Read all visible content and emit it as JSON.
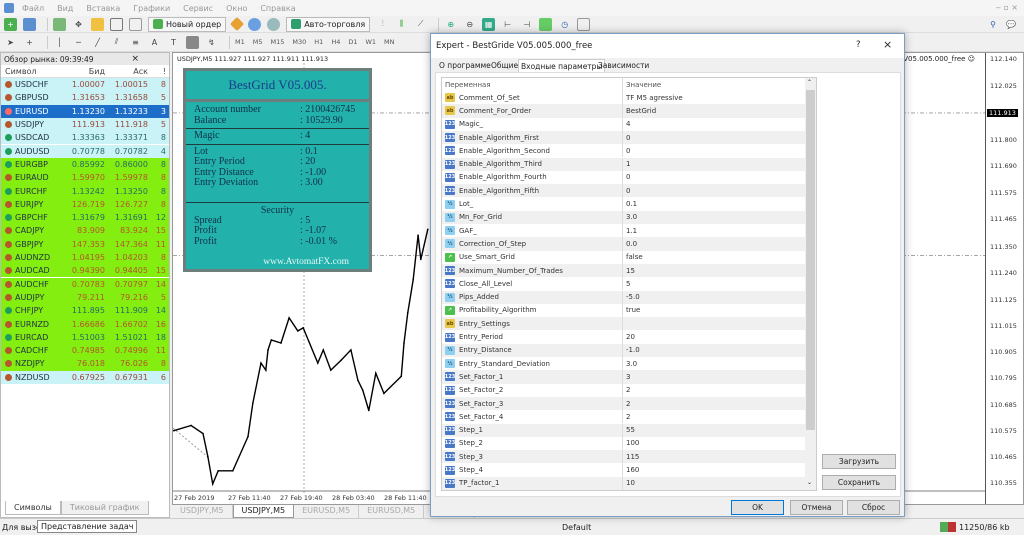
{
  "menu": [
    "Файл",
    "Вид",
    "Вставка",
    "Графики",
    "Сервис",
    "Окно",
    "Справка"
  ],
  "toolbar": {
    "new_order": "Новый ордер",
    "autotrading": "Авто-торговля"
  },
  "timeframes": [
    "M1",
    "M5",
    "M15",
    "M30",
    "H1",
    "H4",
    "D1",
    "W1",
    "MN"
  ],
  "market_watch": {
    "title": "Обзор рынка: 09:39:49",
    "columns": [
      "Символ",
      "Бид",
      "Аск",
      "!"
    ],
    "selected": "EURUSD",
    "colors": {
      "cyan": "#c9f3f7",
      "green": "#83ee0f",
      "selected": "#1c6ec9",
      "up": "#1e9e5a",
      "down": "#b5562e"
    },
    "rows": [
      {
        "symbol": "USDCHF",
        "bid": "1.00007",
        "ask": "1.00015",
        "spread": "8",
        "dir": "down",
        "bg": "cyan"
      },
      {
        "symbol": "GBPUSD",
        "bid": "1.31653",
        "ask": "1.31658",
        "spread": "5",
        "dir": "down",
        "bg": "cyan"
      },
      {
        "symbol": "EURUSD",
        "bid": "1.13230",
        "ask": "1.13233",
        "spread": "3",
        "dir": "down",
        "bg": "selected"
      },
      {
        "symbol": "USDJPY",
        "bid": "111.913",
        "ask": "111.918",
        "spread": "5",
        "dir": "down",
        "bg": "cyan"
      },
      {
        "symbol": "USDCAD",
        "bid": "1.33363",
        "ask": "1.33371",
        "spread": "8",
        "dir": "up",
        "bg": "cyan"
      },
      {
        "symbol": "AUDUSD",
        "bid": "0.70778",
        "ask": "0.70782",
        "spread": "4",
        "dir": "up",
        "bg": "cyan"
      },
      {
        "symbol": "EURGBP",
        "bid": "0.85992",
        "ask": "0.86000",
        "spread": "8",
        "dir": "up",
        "bg": "green"
      },
      {
        "symbol": "EURAUD",
        "bid": "1.59970",
        "ask": "1.59978",
        "spread": "8",
        "dir": "down",
        "bg": "green"
      },
      {
        "symbol": "EURCHF",
        "bid": "1.13242",
        "ask": "1.13250",
        "spread": "8",
        "dir": "up",
        "bg": "green"
      },
      {
        "symbol": "EURJPY",
        "bid": "126.719",
        "ask": "126.727",
        "spread": "8",
        "dir": "down",
        "bg": "green"
      },
      {
        "symbol": "GBPCHF",
        "bid": "1.31679",
        "ask": "1.31691",
        "spread": "12",
        "dir": "up",
        "bg": "green"
      },
      {
        "symbol": "CADJPY",
        "bid": "83.909",
        "ask": "83.924",
        "spread": "15",
        "dir": "down",
        "bg": "green"
      },
      {
        "symbol": "GBPJPY",
        "bid": "147.353",
        "ask": "147.364",
        "spread": "11",
        "dir": "down",
        "bg": "green"
      },
      {
        "symbol": "AUDNZD",
        "bid": "1.04195",
        "ask": "1.04203",
        "spread": "8",
        "dir": "down",
        "bg": "green"
      },
      {
        "symbol": "AUDCAD",
        "bid": "0.94390",
        "ask": "0.94405",
        "spread": "15",
        "dir": "down",
        "bg": "green"
      },
      {
        "symbol": "AUDCHF",
        "bid": "0.70783",
        "ask": "0.70797",
        "spread": "14",
        "dir": "down",
        "bg": "green"
      },
      {
        "symbol": "AUDJPY",
        "bid": "79.211",
        "ask": "79.216",
        "spread": "5",
        "dir": "down",
        "bg": "green"
      },
      {
        "symbol": "CHFJPY",
        "bid": "111.895",
        "ask": "111.909",
        "spread": "14",
        "dir": "up",
        "bg": "green"
      },
      {
        "symbol": "EURNZD",
        "bid": "1.66686",
        "ask": "1.66702",
        "spread": "16",
        "dir": "down",
        "bg": "green"
      },
      {
        "symbol": "EURCAD",
        "bid": "1.51003",
        "ask": "1.51021",
        "spread": "18",
        "dir": "up",
        "bg": "green"
      },
      {
        "symbol": "CADCHF",
        "bid": "0.74985",
        "ask": "0.74996",
        "spread": "11",
        "dir": "down",
        "bg": "green"
      },
      {
        "symbol": "NZDJPY",
        "bid": "76.018",
        "ask": "76.026",
        "spread": "8",
        "dir": "down",
        "bg": "green"
      },
      {
        "symbol": "NZDUSD",
        "bid": "0.67925",
        "ask": "0.67931",
        "spread": "6",
        "dir": "down",
        "bg": "cyan"
      }
    ],
    "tabs": [
      "Символы",
      "Тиковый график"
    ]
  },
  "chart": {
    "title": "USDJPY,M5  111.927 111.927 111.911 111.913",
    "ea_label": "BestGride  V05.005.000_free",
    "bid": 111.913,
    "price_labels": [
      "112.140",
      "112.025",
      "111.800",
      "111.690",
      "111.575",
      "111.465",
      "111.350",
      "111.240",
      "111.125",
      "111.015",
      "110.905",
      "110.795",
      "110.685",
      "110.575",
      "110.465",
      "110.355"
    ],
    "time_labels": [
      "27 Feb 2019",
      "27 Feb 11:40",
      "27 Feb 19:40",
      "28 Feb 03:40",
      "28 Feb 11:40"
    ],
    "price_series": [
      [
        "27 Feb 03:10",
        110.575
      ],
      [
        "27 Feb 05:50",
        110.597
      ],
      [
        "27 Feb 07:40",
        110.563
      ],
      [
        "27 Feb 08:25",
        110.465
      ],
      [
        "27 Feb 09:10",
        110.351
      ],
      [
        "27 Feb 10:00",
        110.406
      ],
      [
        "27 Feb 12:15",
        110.406
      ],
      [
        "27 Feb 14:35",
        110.55
      ],
      [
        "27 Feb 15:20",
        110.69
      ],
      [
        "27 Feb 16:35",
        110.86
      ],
      [
        "27 Feb 17:20",
        110.83
      ],
      [
        "27 Feb 17:40",
        110.915
      ],
      [
        "27 Feb 18:10",
        110.957
      ],
      [
        "27 Feb 19:40",
        110.944
      ],
      [
        "27 Feb 20:55",
        111.05
      ],
      [
        "27 Feb 22:15",
        110.995
      ],
      [
        "27 Feb 23:05",
        111.008
      ],
      [
        "28 Feb 01:20",
        110.86
      ],
      [
        "28 Feb 02:10",
        110.915
      ],
      [
        "28 Feb 03:20",
        110.83
      ],
      [
        "28 Feb 04:55",
        110.872
      ],
      [
        "28 Feb 06:25",
        110.915
      ],
      [
        "28 Feb 07:30",
        110.787
      ],
      [
        "28 Feb 08:15",
        110.745
      ],
      [
        "28 Feb 09:10",
        110.66
      ],
      [
        "28 Feb 10:15",
        110.817
      ],
      [
        "28 Feb 11:30",
        110.732
      ],
      [
        "28 Feb 14:10",
        110.804
      ],
      [
        "28 Feb 14:35",
        110.944
      ],
      [
        "28 Feb 15:10",
        111.072
      ],
      [
        "28 Feb 16:00",
        111.211
      ],
      [
        "28 Feb 16:45",
        111.398
      ],
      [
        "28 Feb 17:10",
        111.296
      ],
      [
        "28 Feb 18:15",
        111.423
      ]
    ],
    "tabs": [
      "USDJPY,M5",
      "USDJPY,M5",
      "EURUSD,M5",
      "EURUSD,M5",
      "EURUSD"
    ],
    "active_tab": 1
  },
  "info_panel": {
    "title": "BestGrid V05.005.",
    "rows1": [
      [
        "Account number",
        ": 2100426745"
      ],
      [
        "Balance",
        ": 10529.90"
      ]
    ],
    "rows2": [
      [
        "Magic",
        ": 4"
      ]
    ],
    "rows3": [
      [
        "Lot",
        ": 0.1"
      ],
      [
        "Entry Period",
        ": 20"
      ],
      [
        "Entry Distance",
        ": -1.00"
      ],
      [
        "Entry Deviation",
        ": 3.00"
      ]
    ],
    "security": "Security",
    "rows4": [
      [
        "Spread",
        ": 5"
      ],
      [
        "Profit",
        ": -1.07"
      ],
      [
        "Profit",
        ": -0.01  %"
      ]
    ],
    "website": "www.AvtomatFX.com",
    "bg_color": "#22b2ab"
  },
  "dialog": {
    "title": "Expert - BestGride  V05.005.000_free",
    "help": "?",
    "tabs": [
      "О программе",
      "Общие",
      "Входные параметры",
      "Зависимости"
    ],
    "active_tab": 2,
    "columns": [
      "Переменная",
      "Значение"
    ],
    "params": [
      {
        "name": "Comment_Of_Set",
        "value": "TF M5 agressive",
        "type": "ab"
      },
      {
        "name": "Comment_For_Order",
        "value": "BestGrid",
        "type": "ab"
      },
      {
        "name": "Magic_",
        "value": "4",
        "type": "int"
      },
      {
        "name": "Enable_Algorithm_First",
        "value": "0",
        "type": "int"
      },
      {
        "name": "Enable_Algorithm_Second",
        "value": "0",
        "type": "int"
      },
      {
        "name": "Enable_Algorithm_Third",
        "value": "1",
        "type": "int"
      },
      {
        "name": "Enable_Algorithm_Fourth",
        "value": "0",
        "type": "int"
      },
      {
        "name": "Enable_Algorithm_Fifth",
        "value": "0",
        "type": "int"
      },
      {
        "name": "Lot_",
        "value": "0.1",
        "type": "dbl"
      },
      {
        "name": "Mn_For_Grid",
        "value": "3.0",
        "type": "dbl"
      },
      {
        "name": "GAF_",
        "value": "1.1",
        "type": "dbl"
      },
      {
        "name": "Correction_Of_Step",
        "value": "0.0",
        "type": "dbl"
      },
      {
        "name": "Use_Smart_Grid",
        "value": "false",
        "type": "bool"
      },
      {
        "name": "Maximum_Number_Of_Trades",
        "value": "15",
        "type": "int"
      },
      {
        "name": "Close_All_Level",
        "value": "5",
        "type": "int"
      },
      {
        "name": "Pips_Added",
        "value": "-5.0",
        "type": "dbl"
      },
      {
        "name": "Profitability_Algorithm",
        "value": "true",
        "type": "bool"
      },
      {
        "name": "Entry_Settings",
        "value": "",
        "type": "ab"
      },
      {
        "name": "Entry_Period",
        "value": "20",
        "type": "int"
      },
      {
        "name": "Entry_Distance",
        "value": "-1.0",
        "type": "dbl"
      },
      {
        "name": "Entry_Standard_Deviation",
        "value": "3.0",
        "type": "dbl"
      },
      {
        "name": "Set_Factor_1",
        "value": "3",
        "type": "int"
      },
      {
        "name": "Set_Factor_2",
        "value": "2",
        "type": "int"
      },
      {
        "name": "Set_Factor_3",
        "value": "2",
        "type": "int"
      },
      {
        "name": "Set_Factor_4",
        "value": "2",
        "type": "int"
      },
      {
        "name": "Step_1",
        "value": "55",
        "type": "int"
      },
      {
        "name": "Step_2",
        "value": "100",
        "type": "int"
      },
      {
        "name": "Step_3",
        "value": "115",
        "type": "int"
      },
      {
        "name": "Step_4",
        "value": "160",
        "type": "int"
      },
      {
        "name": "TP_factor_1",
        "value": "10",
        "type": "int"
      }
    ],
    "icon_labels": {
      "ab": "ab",
      "int": "123",
      "dbl": "½",
      "bool": "↗"
    },
    "load": "Загрузить",
    "save": "Сохранить",
    "ok": "OK",
    "cancel": "Отмена",
    "reset": "Сброс"
  },
  "status": {
    "left": "Для вызо",
    "tooltip": "Представление задач",
    "profile": "Default",
    "traffic": "11250/86 kb"
  }
}
